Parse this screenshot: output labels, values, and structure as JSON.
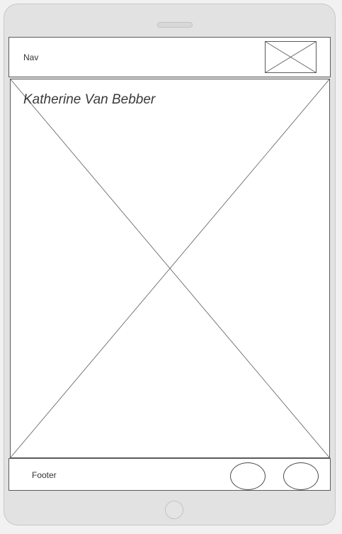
{
  "nav": {
    "label": "Nav",
    "image_icon": "image-placeholder-icon"
  },
  "hero": {
    "title": "Katherine Van Bebber",
    "image_icon": "image-placeholder-icon"
  },
  "footer": {
    "label": "Footer",
    "buttons": [
      "circle-button",
      "circle-button"
    ]
  },
  "colors": {
    "device_frame": "#e2e2e2",
    "page_background": "#f1f1f1",
    "wireframe_stroke": "#5a5a5a",
    "text": "#333333"
  }
}
